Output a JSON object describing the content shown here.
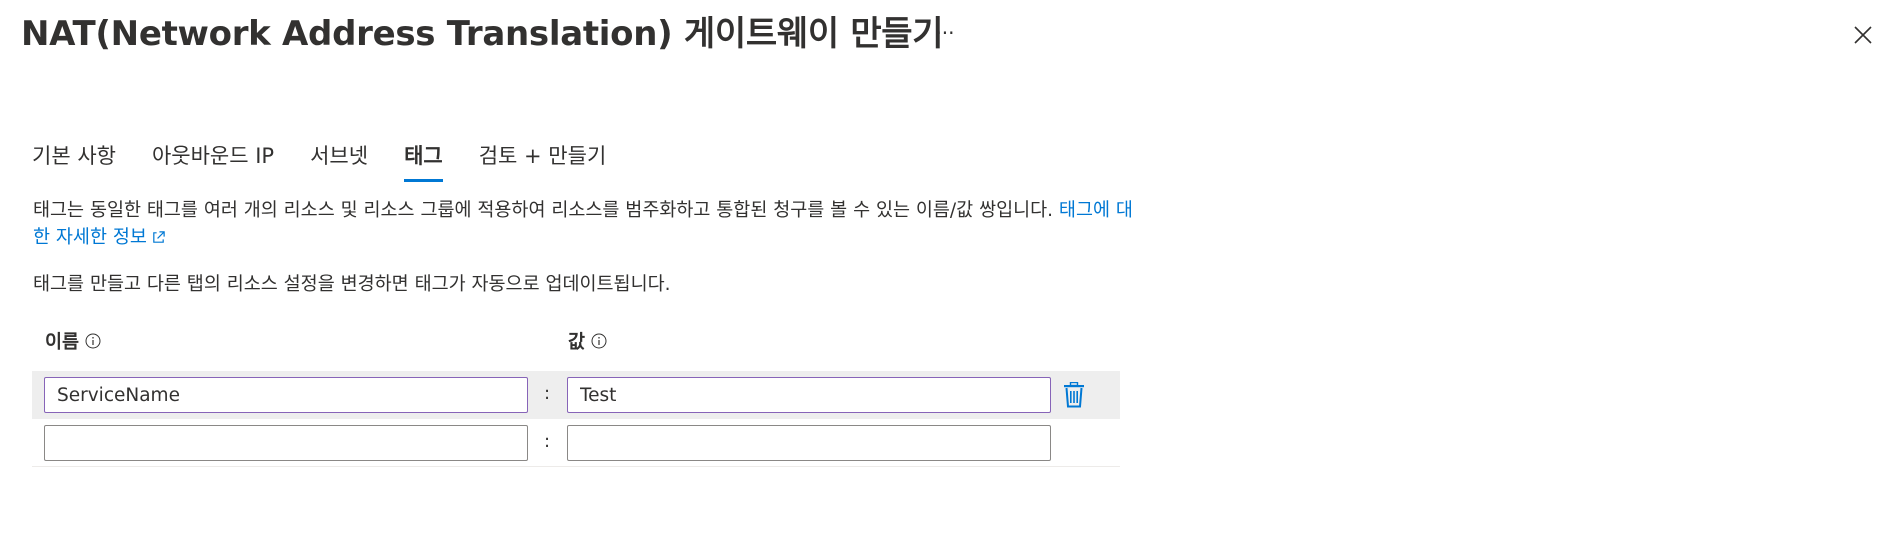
{
  "header": {
    "title": "NAT(Network Address Translation) 게이트웨이 만들기",
    "more_label": "···",
    "close_icon": "close-icon"
  },
  "tabs": [
    {
      "label": "기본 사항",
      "active": false
    },
    {
      "label": "아웃바운드 IP",
      "active": false
    },
    {
      "label": "서브넷",
      "active": false
    },
    {
      "label": "태그",
      "active": true
    },
    {
      "label": "검토 + 만들기",
      "active": false
    }
  ],
  "description": {
    "text": "태그는 동일한 태그를 여러 개의 리소스 및 리소스 그룹에 적용하여 리소스를 범주화하고 통합된 청구를 볼 수 있는 이름/값 쌍입니다.",
    "link": "태그에 대한 자세한 정보",
    "note": "태그를 만들고 다른 탭의 리소스 설정을 변경하면 태그가 자동으로 업데이트됩니다."
  },
  "table": {
    "name_header": "이름",
    "value_header": "값",
    "separator": ":",
    "rows": [
      {
        "name": "ServiceName",
        "value": "Test"
      },
      {
        "name": "",
        "value": ""
      }
    ]
  },
  "colors": {
    "accent": "#0078d4",
    "selected_input_border": "#8764b8",
    "row_highlight": "#eeeeee"
  }
}
